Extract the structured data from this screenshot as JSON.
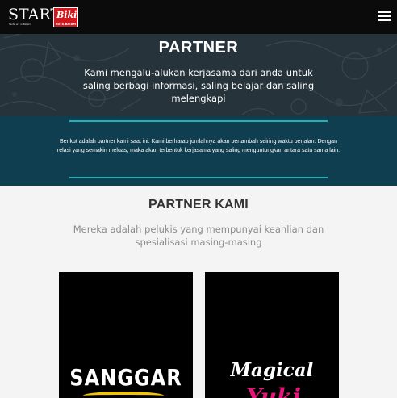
{
  "header": {
    "logo": {
      "word": "START",
      "box_word": "Biki",
      "box_sub": "KOTA BATAM",
      "tagline": "Taste art in Batam"
    },
    "menu_icon": "hamburger-menu-icon"
  },
  "hero": {
    "title": "PARTNER",
    "text": "Kami mengalu-alukan kerjasama dari anda untuk saling berbagi informasi, saling belajar dan saling melengkapi"
  },
  "intro": {
    "text": "Berikut adalah partner kami saat ini. Kami berharap jumlahnya akan bertambah seiring waktu berjalan. Dengan relasi yang semakin meluas, maka akan terbentuk kerjasama yang saling menguntungkan antara satu sama lain."
  },
  "partners_section": {
    "title": "PARTNER KAMI",
    "subtitle": "Mereka adalah pelukis yang mempunyai keahlian dan spesialisasi masing-masing",
    "cards": [
      {
        "title": "SANGGAR"
      },
      {
        "title": "Magical",
        "subtitle": "Yuki"
      }
    ]
  },
  "colors": {
    "topbar": "#0b0b0b",
    "hero_bg": "#26333a",
    "intro_bg": "#0e3e4f",
    "accent_line": "#23b0b6",
    "logo_red": "#d2161d",
    "card_pink": "#e8157a",
    "card_yellow": "#f2c500"
  }
}
